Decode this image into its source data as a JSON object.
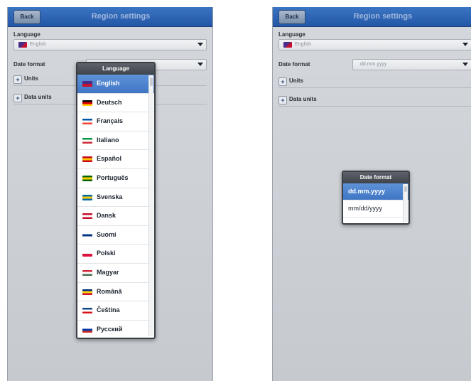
{
  "left": {
    "back_label": "Back",
    "title": "Region settings",
    "language_label": "Language",
    "language_value": "English",
    "date_format_label": "Date format",
    "units_label": "Units",
    "data_units_label": "Data units",
    "popup": {
      "title": "Language",
      "items": [
        {
          "label": "English",
          "colors": [
            "#4a2c88",
            "#c8102e"
          ],
          "selected": true
        },
        {
          "label": "Deutsch",
          "colors": [
            "#000000",
            "#dd0000",
            "#ffce00"
          ]
        },
        {
          "label": "Français",
          "colors": [
            "#0055a4",
            "#ffffff",
            "#ef4135"
          ]
        },
        {
          "label": "Italiano",
          "colors": [
            "#009246",
            "#ffffff",
            "#ce2b37"
          ]
        },
        {
          "label": "Español",
          "colors": [
            "#c60b1e",
            "#ffc400",
            "#c60b1e"
          ]
        },
        {
          "label": "Português",
          "colors": [
            "#006600",
            "#ffcc00",
            "#006600"
          ]
        },
        {
          "label": "Svenska",
          "colors": [
            "#006aa7",
            "#fecc00",
            "#006aa7"
          ]
        },
        {
          "label": "Dansk",
          "colors": [
            "#c8102e",
            "#ffffff",
            "#c8102e"
          ]
        },
        {
          "label": "Suomi",
          "colors": [
            "#ffffff",
            "#003580",
            "#ffffff"
          ]
        },
        {
          "label": "Polski",
          "colors": [
            "#ffffff",
            "#dc143c"
          ]
        },
        {
          "label": "Magyar",
          "colors": [
            "#ce2939",
            "#ffffff",
            "#477050"
          ]
        },
        {
          "label": "Română",
          "colors": [
            "#002b7f",
            "#fcd116",
            "#ce1126"
          ]
        },
        {
          "label": "Čeština",
          "colors": [
            "#11457e",
            "#ffffff",
            "#d7141a"
          ]
        },
        {
          "label": "Русский",
          "colors": [
            "#ffffff",
            "#0039a6",
            "#d52b1e"
          ]
        }
      ]
    }
  },
  "right": {
    "back_label": "Back",
    "title": "Region settings",
    "language_label": "Language",
    "language_value": "English",
    "date_format_label": "Date format",
    "date_format_value": "dd.mm.yyyy",
    "units_label": "Units",
    "data_units_label": "Data units",
    "popup": {
      "title": "Date format",
      "items": [
        {
          "label": "dd.mm.yyyy",
          "selected": true
        },
        {
          "label": "mm/dd/yyyy"
        }
      ]
    }
  },
  "colors": {
    "titlebar": "#2f67b6",
    "selected": "#4a82cf",
    "screen_bg": "#cdd1d6"
  }
}
